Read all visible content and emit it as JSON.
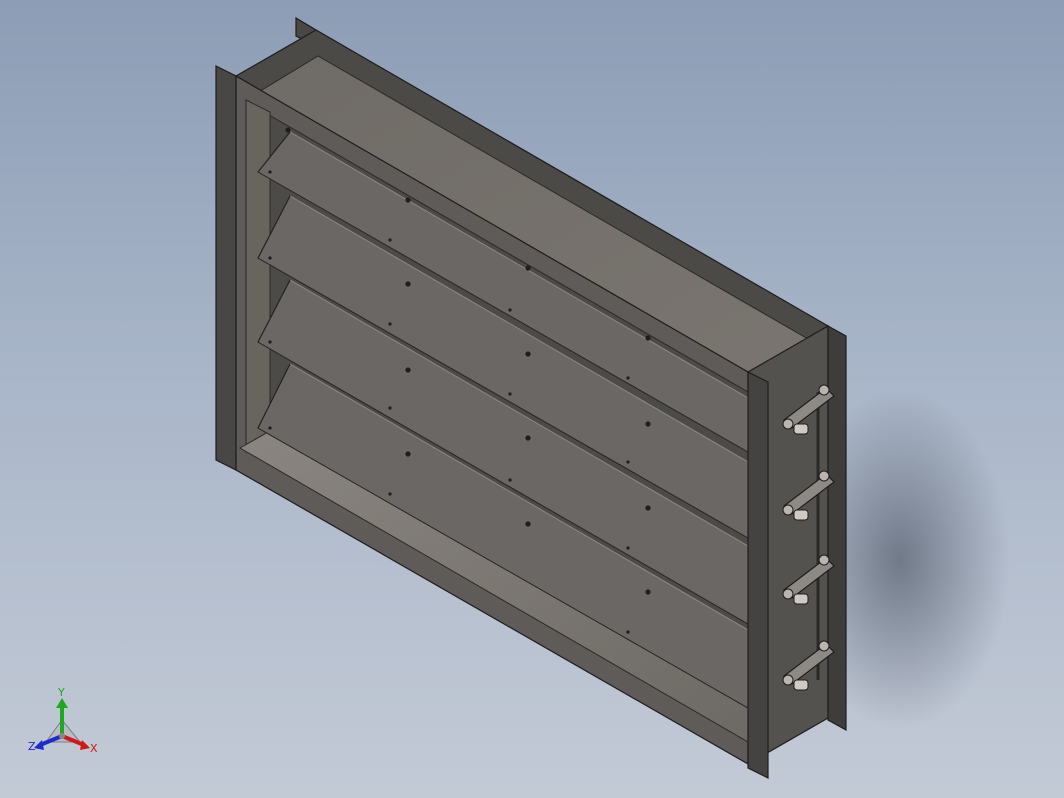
{
  "triad": {
    "x_label": "X",
    "y_label": "Y",
    "z_label": "Z"
  },
  "colors": {
    "frame_dark": "#3e3c3a",
    "frame_face": "#5b5956",
    "inner_face": "#75716c",
    "blade_face": "#6a6764",
    "x_axis": "#d01818",
    "y_axis": "#1fa81f",
    "z_axis": "#1a2ccc"
  }
}
